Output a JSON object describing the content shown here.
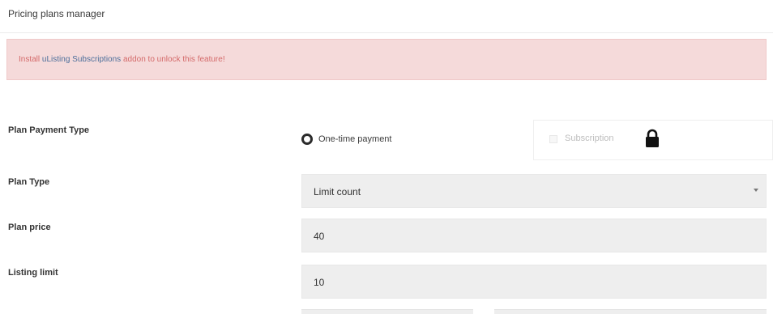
{
  "header": {
    "title": "Pricing plans manager"
  },
  "notice": {
    "prefix": "Install ",
    "link": "uListing Subscriptions",
    "suffix": " addon to unlock this feature!"
  },
  "form": {
    "payment_type": {
      "label": "Plan Payment Type",
      "options": [
        {
          "label": "One-time payment",
          "selected": true
        },
        {
          "label": "Subscription",
          "locked": true,
          "icon": "lock-icon"
        }
      ]
    },
    "plan_type": {
      "label": "Plan Type",
      "value": "Limit count",
      "icon": "caret-down-icon"
    },
    "plan_price": {
      "label": "Plan price",
      "value": "40"
    },
    "listing_limit": {
      "label": "Listing limit",
      "value": "10"
    }
  }
}
